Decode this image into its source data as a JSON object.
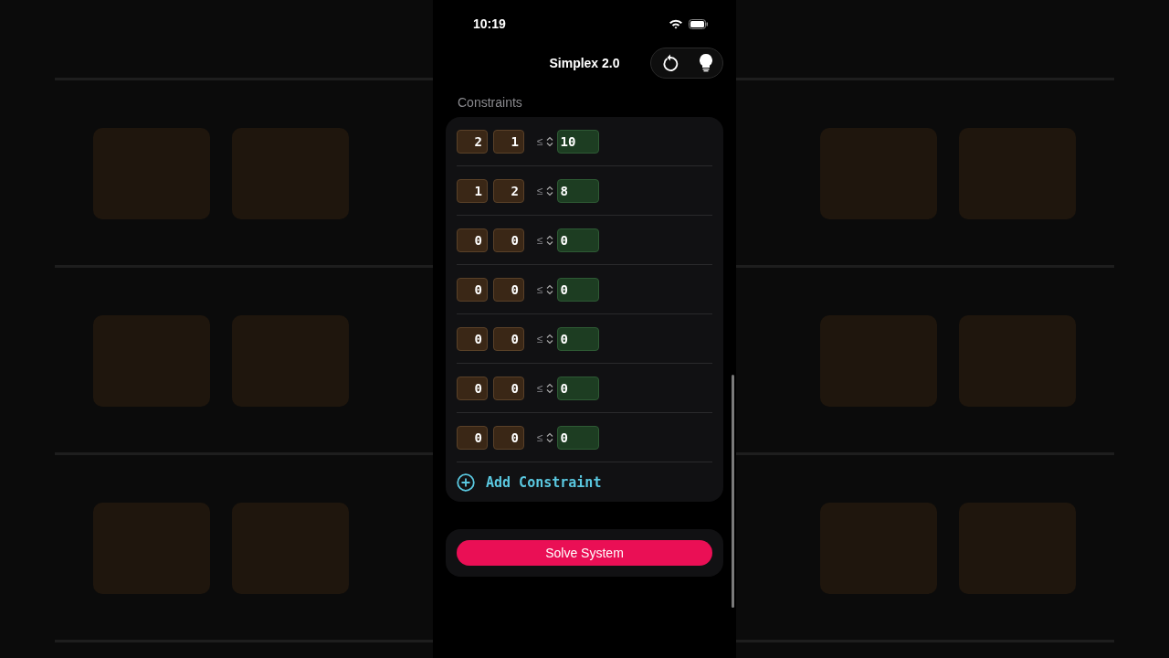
{
  "status_bar": {
    "time": "10:19"
  },
  "header": {
    "title": "Simplex 2.0"
  },
  "constraints": {
    "label": "Constraints",
    "rows": [
      {
        "coefficients": [
          "2",
          "1"
        ],
        "relation": "≤",
        "rhs": "10"
      },
      {
        "coefficients": [
          "1",
          "2"
        ],
        "relation": "≤",
        "rhs": "8"
      },
      {
        "coefficients": [
          "0",
          "0"
        ],
        "relation": "≤",
        "rhs": "0"
      },
      {
        "coefficients": [
          "0",
          "0"
        ],
        "relation": "≤",
        "rhs": "0"
      },
      {
        "coefficients": [
          "0",
          "0"
        ],
        "relation": "≤",
        "rhs": "0"
      },
      {
        "coefficients": [
          "0",
          "0"
        ],
        "relation": "≤",
        "rhs": "0"
      },
      {
        "coefficients": [
          "0",
          "0"
        ],
        "relation": "≤",
        "rhs": "0"
      }
    ],
    "add_button": "Add Constraint"
  },
  "solve_button": "Solve System"
}
